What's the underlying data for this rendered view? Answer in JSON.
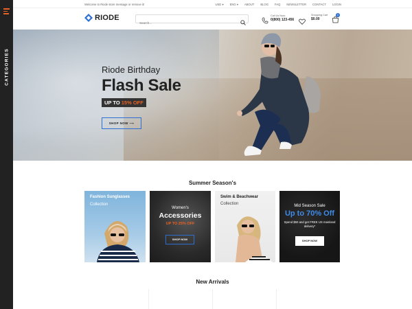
{
  "sidebar": {
    "label": "CATEGORIES"
  },
  "topbar": {
    "welcome": "Welcome to Riode store message or remove it!",
    "links": [
      "USD ▾",
      "ENG ▾",
      "ABOUT",
      "BLOG",
      "FAQ",
      "NEWSLETTER",
      "CONTACT",
      "LOGIN"
    ]
  },
  "header": {
    "logo": "RIODE",
    "search_placeholder": "Search...",
    "call_label": "Call Us Now:",
    "call_number": "0(800) 123-456",
    "cart_label": "Shopping Cart",
    "cart_total": "$0.00",
    "cart_count": "0"
  },
  "hero": {
    "subtitle": "Riode Birthday",
    "title": "Flash Sale",
    "badge_prefix": "UP TO ",
    "badge_pct": "15% OFF",
    "button": "SHOP NOW  ⟶"
  },
  "sections": {
    "summer": "Summer Season's",
    "arrivals": "New Arrivals"
  },
  "banners": {
    "b1": {
      "title": "Fashion Sunglasses",
      "sub": "Collection"
    },
    "b2": {
      "pre": "Women's",
      "title": "Accessories",
      "offer": "UP TO 25% OFF",
      "button": "SHOP NOW"
    },
    "b3": {
      "title": "Swim & Beachwear",
      "sub": "Collection"
    },
    "b4": {
      "pre": "Mid Season Sale",
      "title": "Up to 70% Off",
      "desc": "Spend $50 and get FREE US mainland delivery*",
      "button": "SHOP NOW"
    }
  },
  "colors": {
    "accent": "#e96125",
    "primary": "#2a6fd1",
    "dark": "#222222"
  }
}
